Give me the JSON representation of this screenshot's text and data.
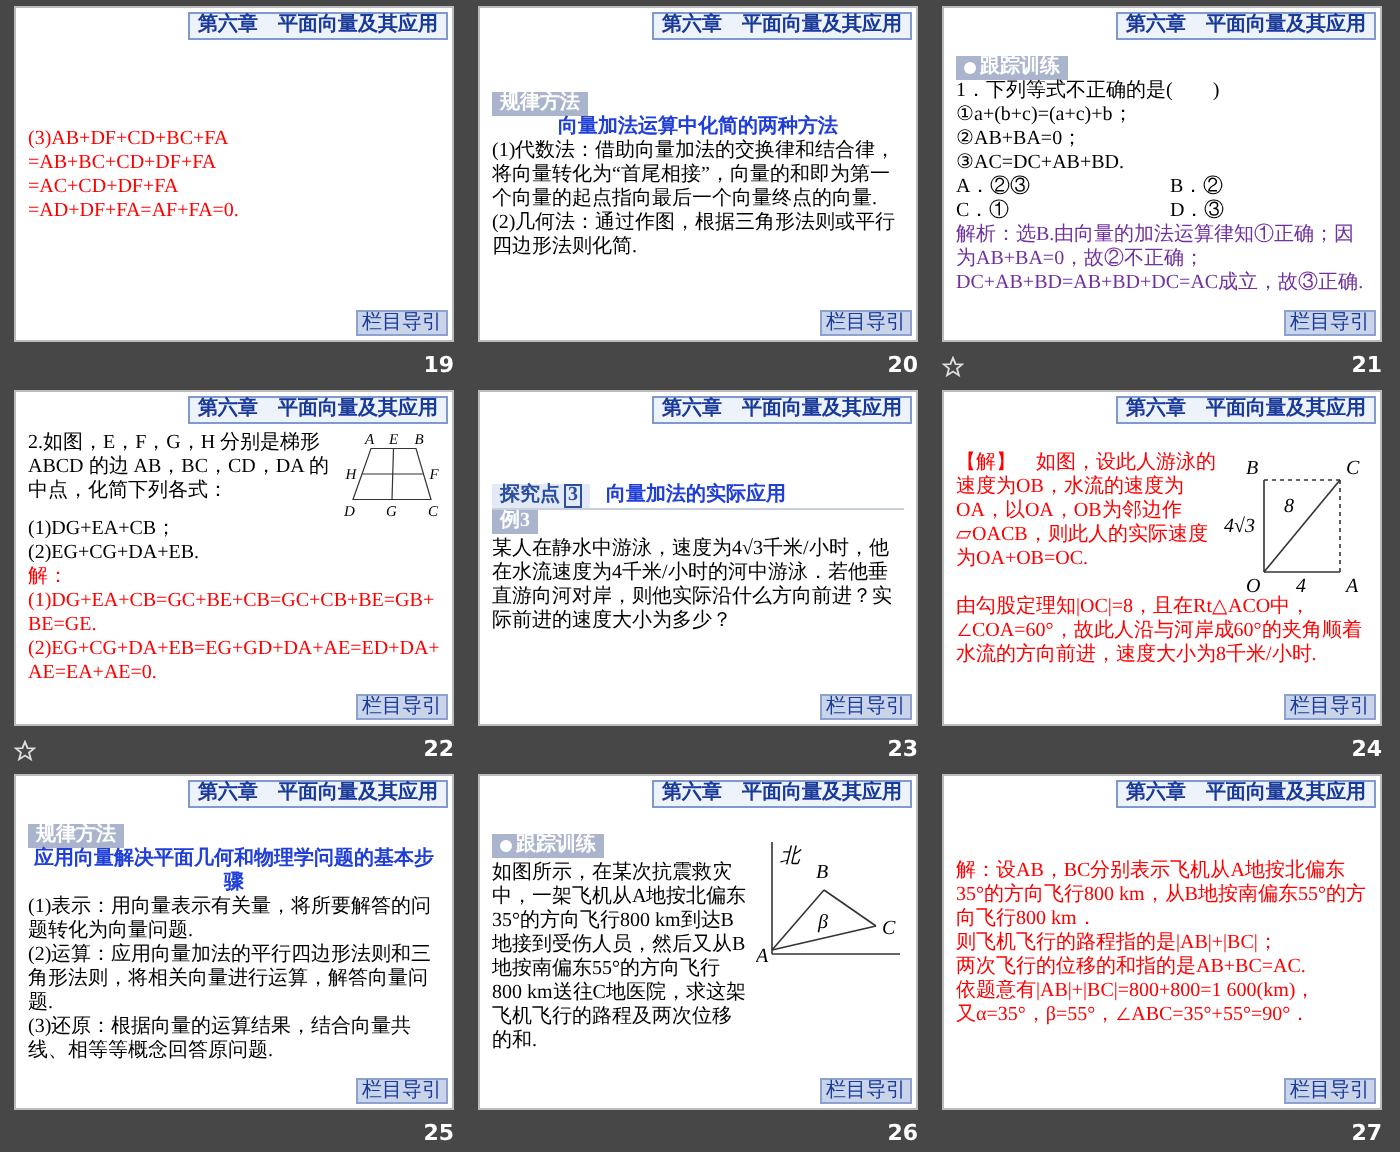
{
  "slides": [
    {
      "number": "19",
      "header": "第六章　平面向量及其应用",
      "nav": "栏目导引",
      "transition": false,
      "blocks": [
        {
          "kind": "para",
          "color": "#ff0000",
          "text": "(3)AB+DF+CD+BC+FA"
        },
        {
          "kind": "para",
          "color": "#ff0000",
          "text": "=AB+BC+CD+DF+FA"
        },
        {
          "kind": "para",
          "color": "#ff0000",
          "text": "=AC+CD+DF+FA"
        },
        {
          "kind": "para",
          "color": "#ff0000",
          "text": "=AD+DF+FA=AF+FA=0."
        }
      ]
    },
    {
      "number": "20",
      "header": "第六章　平面向量及其应用",
      "nav": "栏目导引",
      "transition": false,
      "blocks": [
        {
          "kind": "tag",
          "tag": {
            "text": "规律方法",
            "icon": false
          }
        },
        {
          "kind": "heading",
          "text": "向量加法运算中化简的两种方法"
        },
        {
          "kind": "para",
          "color": "#000000",
          "text": "(1)代数法：借助向量加法的交换律和结合律，将向量转化为“首尾相接”，向量的和即为第一个向量的起点指向最后一个向量终点的向量."
        },
        {
          "kind": "para",
          "color": "#000000",
          "text": "(2)几何法：通过作图，根据三角形法则或平行四边形法则化简."
        }
      ]
    },
    {
      "number": "21",
      "header": "第六章　平面向量及其应用",
      "nav": "栏目导引",
      "transition": true,
      "blocks": [
        {
          "kind": "tag",
          "tag": {
            "text": "跟踪训练",
            "icon": true
          }
        },
        {
          "kind": "para",
          "color": "#000000",
          "text": "1．下列等式不正确的是(　　)"
        },
        {
          "kind": "para",
          "color": "#000000",
          "text": "①a+(b+c)=(a+c)+b；"
        },
        {
          "kind": "para",
          "color": "#000000",
          "text": "②AB+BA=0；"
        },
        {
          "kind": "para",
          "color": "#000000",
          "text": "③AC=DC+AB+BD."
        },
        {
          "kind": "options",
          "items": [
            "A．②③",
            "B．②",
            "C．①",
            "D．③"
          ]
        },
        {
          "kind": "para",
          "color": "#7030a0",
          "text": "解析：选B.由向量的加法运算律知①正确；因为AB+BA=0，故②不正确；DC+AB+BD=AB+BD+DC=AC成立，故③正确."
        }
      ]
    },
    {
      "number": "22",
      "header": "第六章　平面向量及其应用",
      "nav": "栏目导引",
      "transition": true,
      "blocks": [
        {
          "kind": "figure_row",
          "figure": {
            "kind": "trapezoid",
            "labels": [
              "A",
              "E",
              "B",
              "H",
              "F",
              "D",
              "G",
              "C"
            ]
          },
          "blocks": [
            {
              "kind": "para",
              "color": "#000000",
              "text": "2.如图，E，F，G，H 分别是梯形 ABCD 的边 AB，BC，CD，DA 的中点，化简下列各式："
            }
          ]
        },
        {
          "kind": "para",
          "color": "#000000",
          "text": "(1)DG+EA+CB；"
        },
        {
          "kind": "para",
          "color": "#000000",
          "text": "(2)EG+CG+DA+EB."
        },
        {
          "kind": "para",
          "color": "#ff0000",
          "text": "解：(1)DG+EA+CB=GC+BE+CB=GC+CB+BE=GB+BE=GE."
        },
        {
          "kind": "para",
          "color": "#ff0000",
          "text": "(2)EG+CG+DA+EB=EG+GD+DA+AE=ED+DA+AE=EA+AE=0."
        }
      ]
    },
    {
      "number": "23",
      "header": "第六章　平面向量及其应用",
      "nav": "栏目导引",
      "transition": false,
      "blocks": [
        {
          "kind": "section",
          "tag": {
            "text": "探究点",
            "number": "3"
          },
          "text": "向量加法的实际应用"
        },
        {
          "kind": "lead",
          "tag": {
            "text": "例3",
            "icon": false
          },
          "color": "#000000",
          "text": "某人在静水中游泳，速度为4√3千米/小时，他在水流速度为4千米/小时的河中游泳．若他垂直游向河对岸，则他实际沿什么方向前进？实际前进的速度大小为多少？"
        }
      ]
    },
    {
      "number": "24",
      "header": "第六章　平面向量及其应用",
      "nav": "栏目导引",
      "transition": false,
      "blocks": [
        {
          "kind": "figure_row",
          "figure": {
            "kind": "rectangle",
            "labels": [
              "B",
              "C",
              "4√3",
              "8",
              "O",
              "4",
              "A"
            ]
          },
          "blocks": [
            {
              "kind": "para",
              "color": "#ff0000",
              "text": "【解】　如图，设此人游泳的速度为OB，水流的速度为OA，以OA，OB为邻边作▱OACB，则此人的实际速度为OA+OB=OC."
            }
          ]
        },
        {
          "kind": "para",
          "color": "#ff0000",
          "text": "由勾股定理知|OC|=8，且在Rt△ACO中，∠COA=60°，故此人沿与河岸成60°的夹角顺着水流的方向前进，速度大小为8千米/小时."
        }
      ]
    },
    {
      "number": "25",
      "header": "第六章　平面向量及其应用",
      "nav": "栏目导引",
      "transition": false,
      "blocks": [
        {
          "kind": "tag",
          "tag": {
            "text": "规律方法",
            "icon": false
          }
        },
        {
          "kind": "heading",
          "text": "应用向量解决平面几何和物理学问题的基本步骤"
        },
        {
          "kind": "para",
          "color": "#000000",
          "text": "(1)表示：用向量表示有关量，将所要解答的问题转化为向量问题."
        },
        {
          "kind": "para",
          "color": "#000000",
          "text": "(2)运算：应用向量加法的平行四边形法则和三角形法则，将相关向量进行运算，解答向量问题."
        },
        {
          "kind": "para",
          "color": "#000000",
          "text": "(3)还原：根据向量的运算结果，结合向量共线、相等等概念回答原问题."
        }
      ]
    },
    {
      "number": "26",
      "header": "第六章　平面向量及其应用",
      "nav": "栏目导引",
      "transition": false,
      "blocks": [
        {
          "kind": "figure_row",
          "figure": {
            "kind": "flight",
            "labels": [
              "北",
              "B",
              "β",
              "C",
              "A"
            ]
          },
          "blocks": [
            {
              "kind": "lead",
              "tag": {
                "text": "跟踪训练",
                "icon": true
              },
              "color": "#000000",
              "text": "如图所示，在某次抗震救灾中，一架飞机从A地按北偏东35°的方向飞行800 km到达B地接到受伤人员，然后又从B地按南偏东55°的方向飞行800 km送往C地医院，求这架飞机飞行的路程及两次位移的和."
            }
          ]
        }
      ]
    },
    {
      "number": "27",
      "header": "第六章　平面向量及其应用",
      "nav": "栏目导引",
      "transition": false,
      "blocks": [
        {
          "kind": "para",
          "color": "#ff0000",
          "text": "解：设AB，BC分别表示飞机从A地按北偏东35°的方向飞行800 km，从B地按南偏东55°的方向飞行800 km．"
        },
        {
          "kind": "para",
          "color": "#ff0000",
          "text": "则飞机飞行的路程指的是|AB|+|BC|；"
        },
        {
          "kind": "para",
          "color": "#ff0000",
          "text": "两次飞行的位移的和指的是AB+BC=AC."
        },
        {
          "kind": "para",
          "color": "#ff0000",
          "text": "依题意有|AB|+|BC|=800+800=1 600(km)，"
        },
        {
          "kind": "para",
          "color": "#ff0000",
          "text": "又α=35°，β=55°，∠ABC=35°+55°=90°．"
        }
      ]
    }
  ]
}
